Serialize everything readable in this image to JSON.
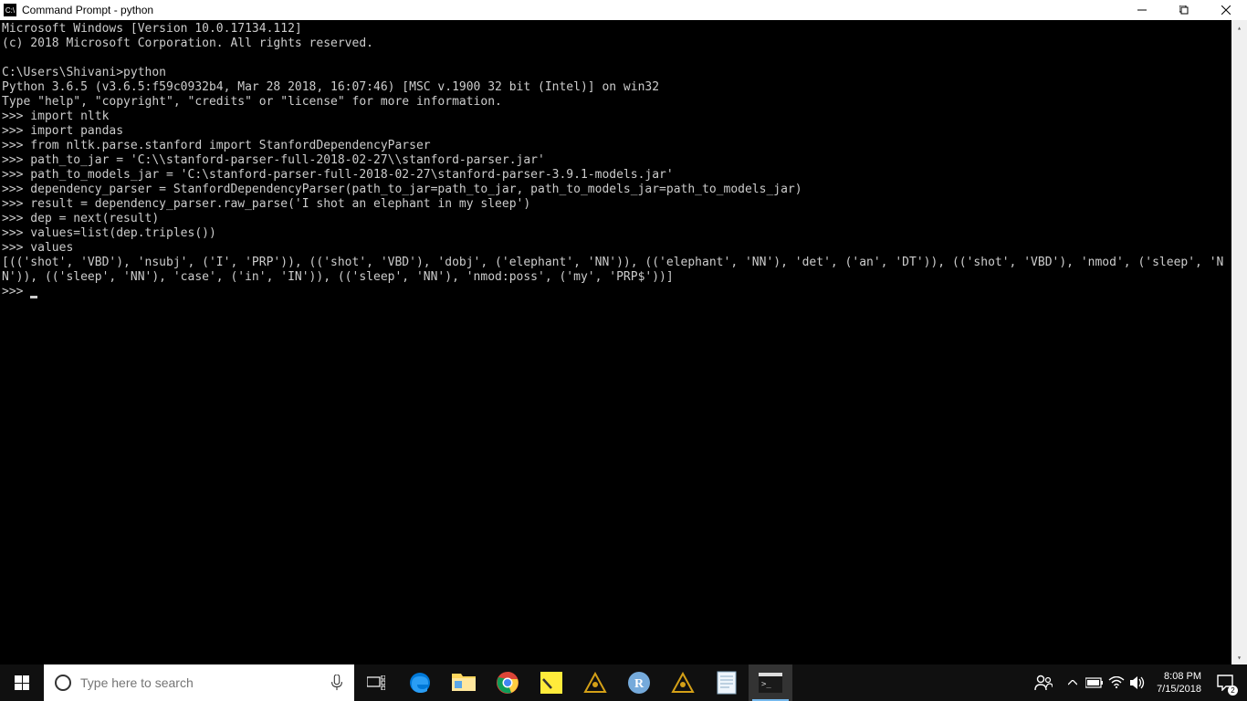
{
  "window": {
    "title": "Command Prompt - python"
  },
  "console": {
    "lines": [
      "Microsoft Windows [Version 10.0.17134.112]",
      "(c) 2018 Microsoft Corporation. All rights reserved.",
      "",
      "C:\\Users\\Shivani>python",
      "Python 3.6.5 (v3.6.5:f59c0932b4, Mar 28 2018, 16:07:46) [MSC v.1900 32 bit (Intel)] on win32",
      "Type \"help\", \"copyright\", \"credits\" or \"license\" for more information.",
      ">>> import nltk",
      ">>> import pandas",
      ">>> from nltk.parse.stanford import StanfordDependencyParser",
      ">>> path_to_jar = 'C:\\\\stanford-parser-full-2018-02-27\\\\stanford-parser.jar'",
      ">>> path_to_models_jar = 'C:\\stanford-parser-full-2018-02-27\\stanford-parser-3.9.1-models.jar'",
      ">>> dependency_parser = StanfordDependencyParser(path_to_jar=path_to_jar, path_to_models_jar=path_to_models_jar)",
      ">>> result = dependency_parser.raw_parse('I shot an elephant in my sleep')",
      ">>> dep = next(result)",
      ">>> values=list(dep.triples())",
      ">>> values",
      "[(('shot', 'VBD'), 'nsubj', ('I', 'PRP')), (('shot', 'VBD'), 'dobj', ('elephant', 'NN')), (('elephant', 'NN'), 'det', ('an', 'DT')), (('shot', 'VBD'), 'nmod', ('sleep', 'NN')), (('sleep', 'NN'), 'case', ('in', 'IN')), (('sleep', 'NN'), 'nmod:poss', ('my', 'PRP$'))]",
      ">>> "
    ]
  },
  "taskbar": {
    "search_placeholder": "Type here to search"
  },
  "systray": {
    "time": "8:08 PM",
    "date": "7/15/2018",
    "notification_count": "2"
  }
}
